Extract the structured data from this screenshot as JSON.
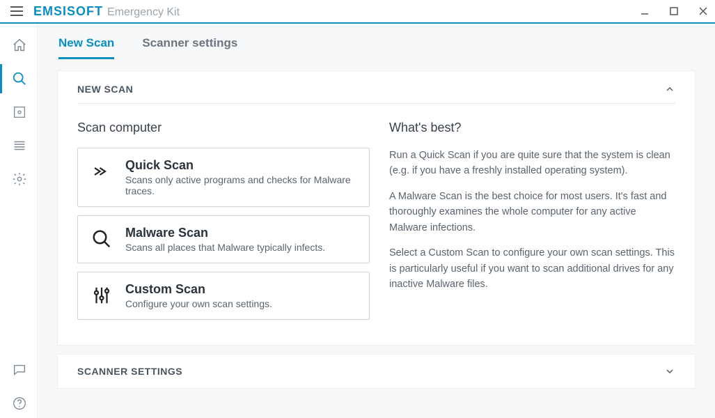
{
  "brand": {
    "logo": "EMSISOFT",
    "sub": "Emergency Kit"
  },
  "tabs": {
    "new_scan": "New Scan",
    "scanner_settings": "Scanner settings"
  },
  "panel_new_scan": {
    "header": "NEW SCAN",
    "left_title": "Scan computer",
    "right_title": "What's best?",
    "para1": "Run a Quick Scan if you are quite sure that the system is clean (e.g. if you have a freshly installed operating system).",
    "para2": "A Malware Scan is the best choice for most users. It's fast and thoroughly examines the whole computer for any active Malware infections.",
    "para3": "Select a Custom Scan to configure your own scan settings. This is particularly useful if you want to scan additional drives for any inactive Malware files."
  },
  "scan_options": {
    "quick": {
      "title": "Quick Scan",
      "desc": "Scans only active programs and checks for Malware traces."
    },
    "malware": {
      "title": "Malware Scan",
      "desc": "Scans all places that Malware typically infects."
    },
    "custom": {
      "title": "Custom Scan",
      "desc": "Configure your own scan settings."
    }
  },
  "panel_settings": {
    "header": "SCANNER SETTINGS"
  },
  "sidebar_items": {
    "home": "home",
    "scan": "scan",
    "quarantine": "quarantine",
    "logs": "logs",
    "settings": "settings",
    "chat": "chat",
    "help": "help"
  }
}
